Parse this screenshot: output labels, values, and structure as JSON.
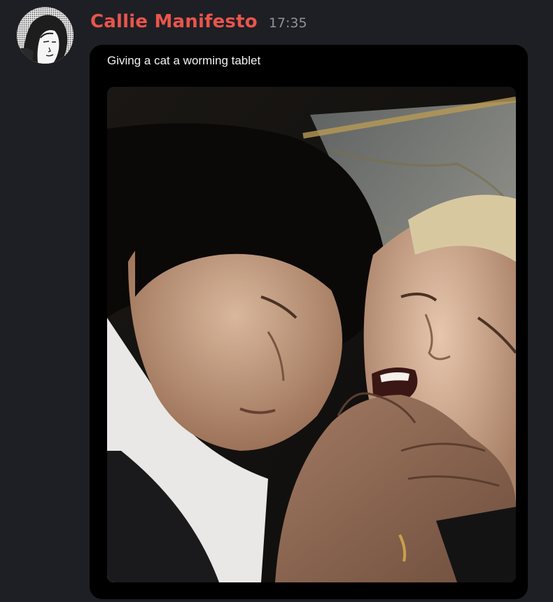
{
  "message": {
    "author": "Callie Manifesto",
    "timestamp": "17:35",
    "text": "Giving a cat a worming tablet"
  },
  "colors": {
    "background": "#1e1f24",
    "username": "#e8554c",
    "timestamp": "#8f9299",
    "embed_background": "#000000",
    "embed_text": "#f2f3f5"
  },
  "icons": {
    "avatar": "avatar-illustration",
    "media": "photo-attachment"
  }
}
